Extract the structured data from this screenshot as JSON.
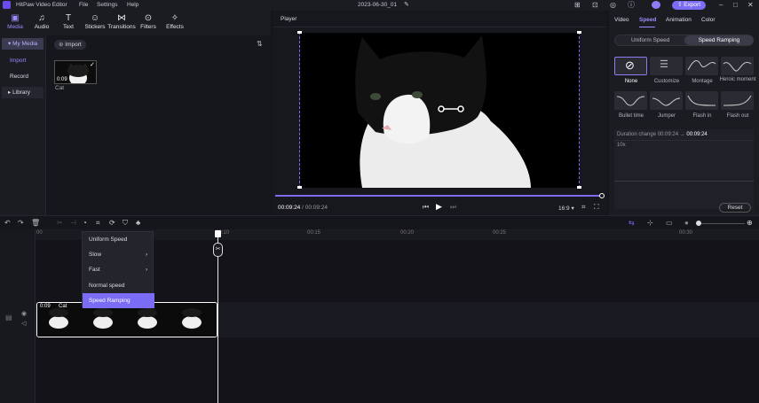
{
  "app": {
    "name": "HitPaw Video Editor",
    "menus": [
      "File",
      "Settings",
      "Help"
    ],
    "project_title": "2023-06-30_01",
    "export_label": "Export"
  },
  "toolbar": {
    "tools": [
      "Media",
      "Audio",
      "Text",
      "Stickers",
      "Transitions",
      "Filters",
      "Effects"
    ]
  },
  "left_nav": {
    "my_media": "My Media",
    "import": "Import",
    "record": "Record",
    "library": "Library"
  },
  "media": {
    "import_button": "Import",
    "clip": {
      "duration": "0:09",
      "name": "Cat"
    }
  },
  "player": {
    "title": "Player",
    "time_current": "00:09:24",
    "time_total": "00:09:24",
    "time_separator": "/",
    "aspect": "16:9",
    "progress": 1.0
  },
  "right_panel": {
    "tabs": [
      "Video",
      "Speed",
      "Animation",
      "Color"
    ],
    "active_tab": "Speed",
    "speed_modes": [
      "Uniform Speed",
      "Speed Ramping"
    ],
    "active_mode": "Speed Ramping",
    "presets_row1": [
      "None",
      "Customize",
      "Montage",
      "Heroic moment"
    ],
    "presets_row2": [
      "Bullet time",
      "Jumper",
      "Flash in",
      "Flash out"
    ],
    "duration_label": "Duration change",
    "duration_from": "00:09:24",
    "duration_arrow": "→",
    "duration_to": "00:09:24",
    "speed_value": "10x",
    "reset_label": "Reset"
  },
  "timeline": {
    "ruler_ticks": [
      "00",
      "00:10",
      "00:15",
      "00:20",
      "00:25",
      "00:30"
    ],
    "clip": {
      "duration": "0:09",
      "name": "Cat"
    }
  },
  "context_menu": {
    "items": [
      "Uniform Speed",
      "Slow",
      "Fast",
      "Normal speed",
      "Speed Ramping"
    ],
    "submenu_arrows": [
      "",
      "›",
      "›",
      "",
      ""
    ],
    "highlighted": "Speed Ramping"
  },
  "colors": {
    "accent": "#7b6cf6",
    "panel": "#1b1b22",
    "background": "#15151c"
  }
}
